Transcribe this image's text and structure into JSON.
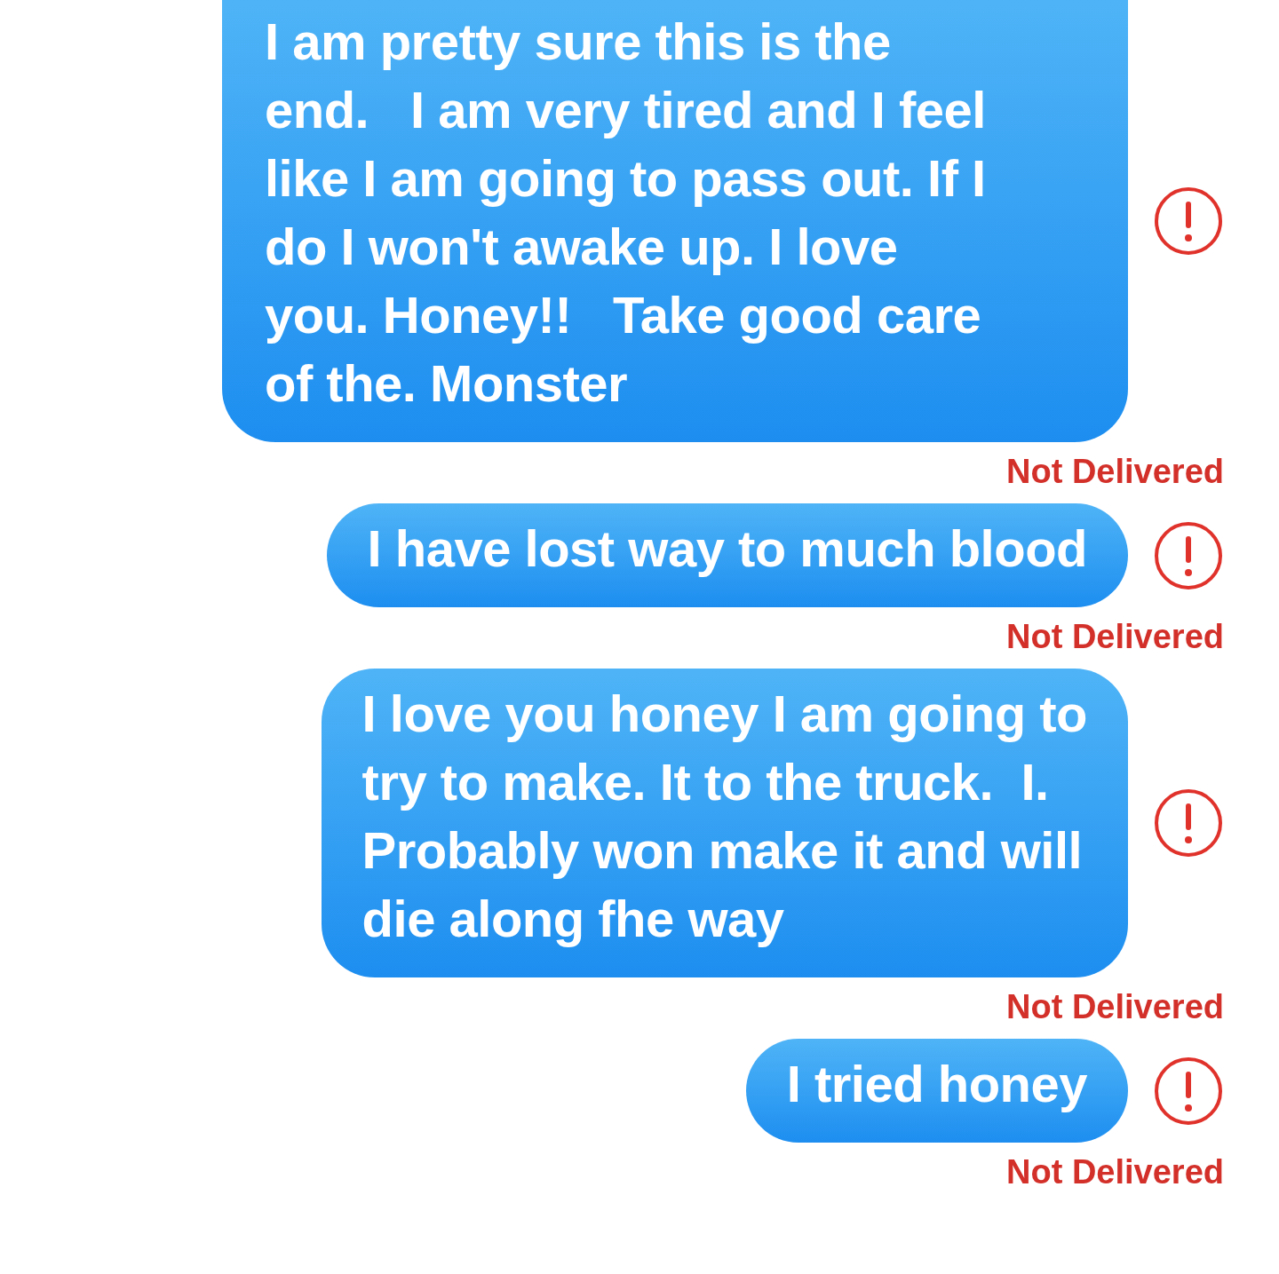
{
  "messages": [
    {
      "text": "I am pretty sure this is the\nend.   I am very tired and I feel\nlike I am going to pass out. If I\ndo I won't awake up. I love\nyou. Honey!!   Take good care\nof the. Monster",
      "failed": true,
      "status": "Not Delivered"
    },
    {
      "text": "I have lost way to much blood",
      "failed": true,
      "status": "Not Delivered"
    },
    {
      "text": "I love you honey I am going to\ntry to make. It to the truck.  I.\nProbably won make it and will\ndie along fhe way",
      "failed": true,
      "status": "Not Delivered"
    },
    {
      "text": "I tried honey",
      "failed": true,
      "status": "Not Delivered"
    }
  ]
}
